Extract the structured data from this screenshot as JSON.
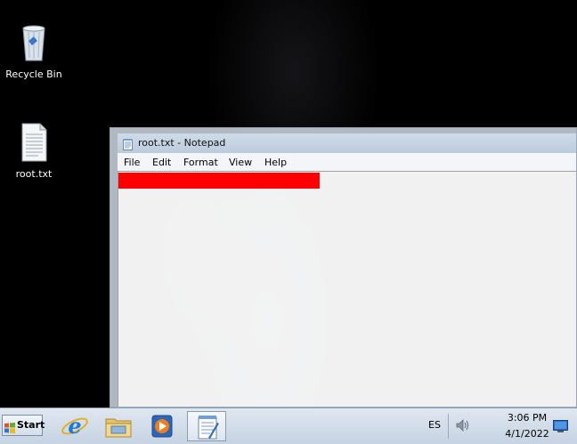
{
  "desktop": {
    "icons": [
      {
        "label": "Recycle Bin",
        "icon": "recycle-bin-icon"
      },
      {
        "label": "root.txt",
        "icon": "text-file-icon"
      }
    ]
  },
  "notepad": {
    "title": "root.txt - Notepad",
    "icon": "notepad-icon",
    "menu": [
      "File",
      "Edit",
      "Format",
      "View",
      "Help"
    ],
    "content_redaction_color": "#ff0000"
  },
  "taskbar": {
    "start_label": "Start",
    "apps": [
      {
        "name": "internet-explorer-icon"
      },
      {
        "name": "file-explorer-icon"
      },
      {
        "name": "media-player-icon"
      },
      {
        "name": "notepad-icon",
        "active": true
      }
    ],
    "language": "ES",
    "tray_icons": [
      "volume-icon",
      "show-desktop-icon"
    ],
    "clock": {
      "time": "3:06 PM",
      "date": "4/1/2022"
    }
  }
}
